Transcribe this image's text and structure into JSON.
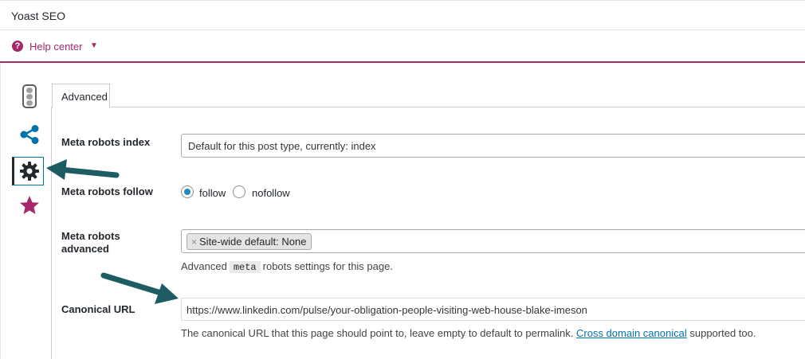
{
  "panel": {
    "title": "Yoast SEO"
  },
  "help": {
    "label": "Help center",
    "icon": "question-circle-icon",
    "caret_icon": "caret-down-icon",
    "accent_color": "#a4286a"
  },
  "sidebar": {
    "icons": [
      "traffic-light-icon",
      "share-icon",
      "gear-icon",
      "star-icon"
    ],
    "active": "gear-icon"
  },
  "tabs": [
    {
      "label": "Advanced",
      "active": true
    }
  ],
  "fields": {
    "robots_index": {
      "label": "Meta robots index",
      "value": "Default for this post type, currently: index"
    },
    "robots_follow": {
      "label": "Meta robots follow",
      "options": [
        {
          "label": "follow",
          "checked": true
        },
        {
          "label": "nofollow",
          "checked": false
        }
      ]
    },
    "robots_advanced": {
      "label_line1": "Meta robots",
      "label_line2": "advanced",
      "chip_remove": "×",
      "chip": "Site-wide default: None",
      "help_before": "Advanced",
      "help_code": "meta",
      "help_after": "robots settings for this page."
    },
    "canonical": {
      "label": "Canonical URL",
      "value": "https://www.linkedin.com/pulse/your-obligation-people-visiting-web-house-blake-imeson",
      "help_before": "The canonical URL that this page should point to, leave empty to default to permalink.",
      "help_link": "Cross domain canonical",
      "help_after": "supported too."
    }
  },
  "colors": {
    "annotation_arrow": "#1d5c63",
    "radio_checked": "#1e8cbe",
    "link": "#0073aa"
  }
}
